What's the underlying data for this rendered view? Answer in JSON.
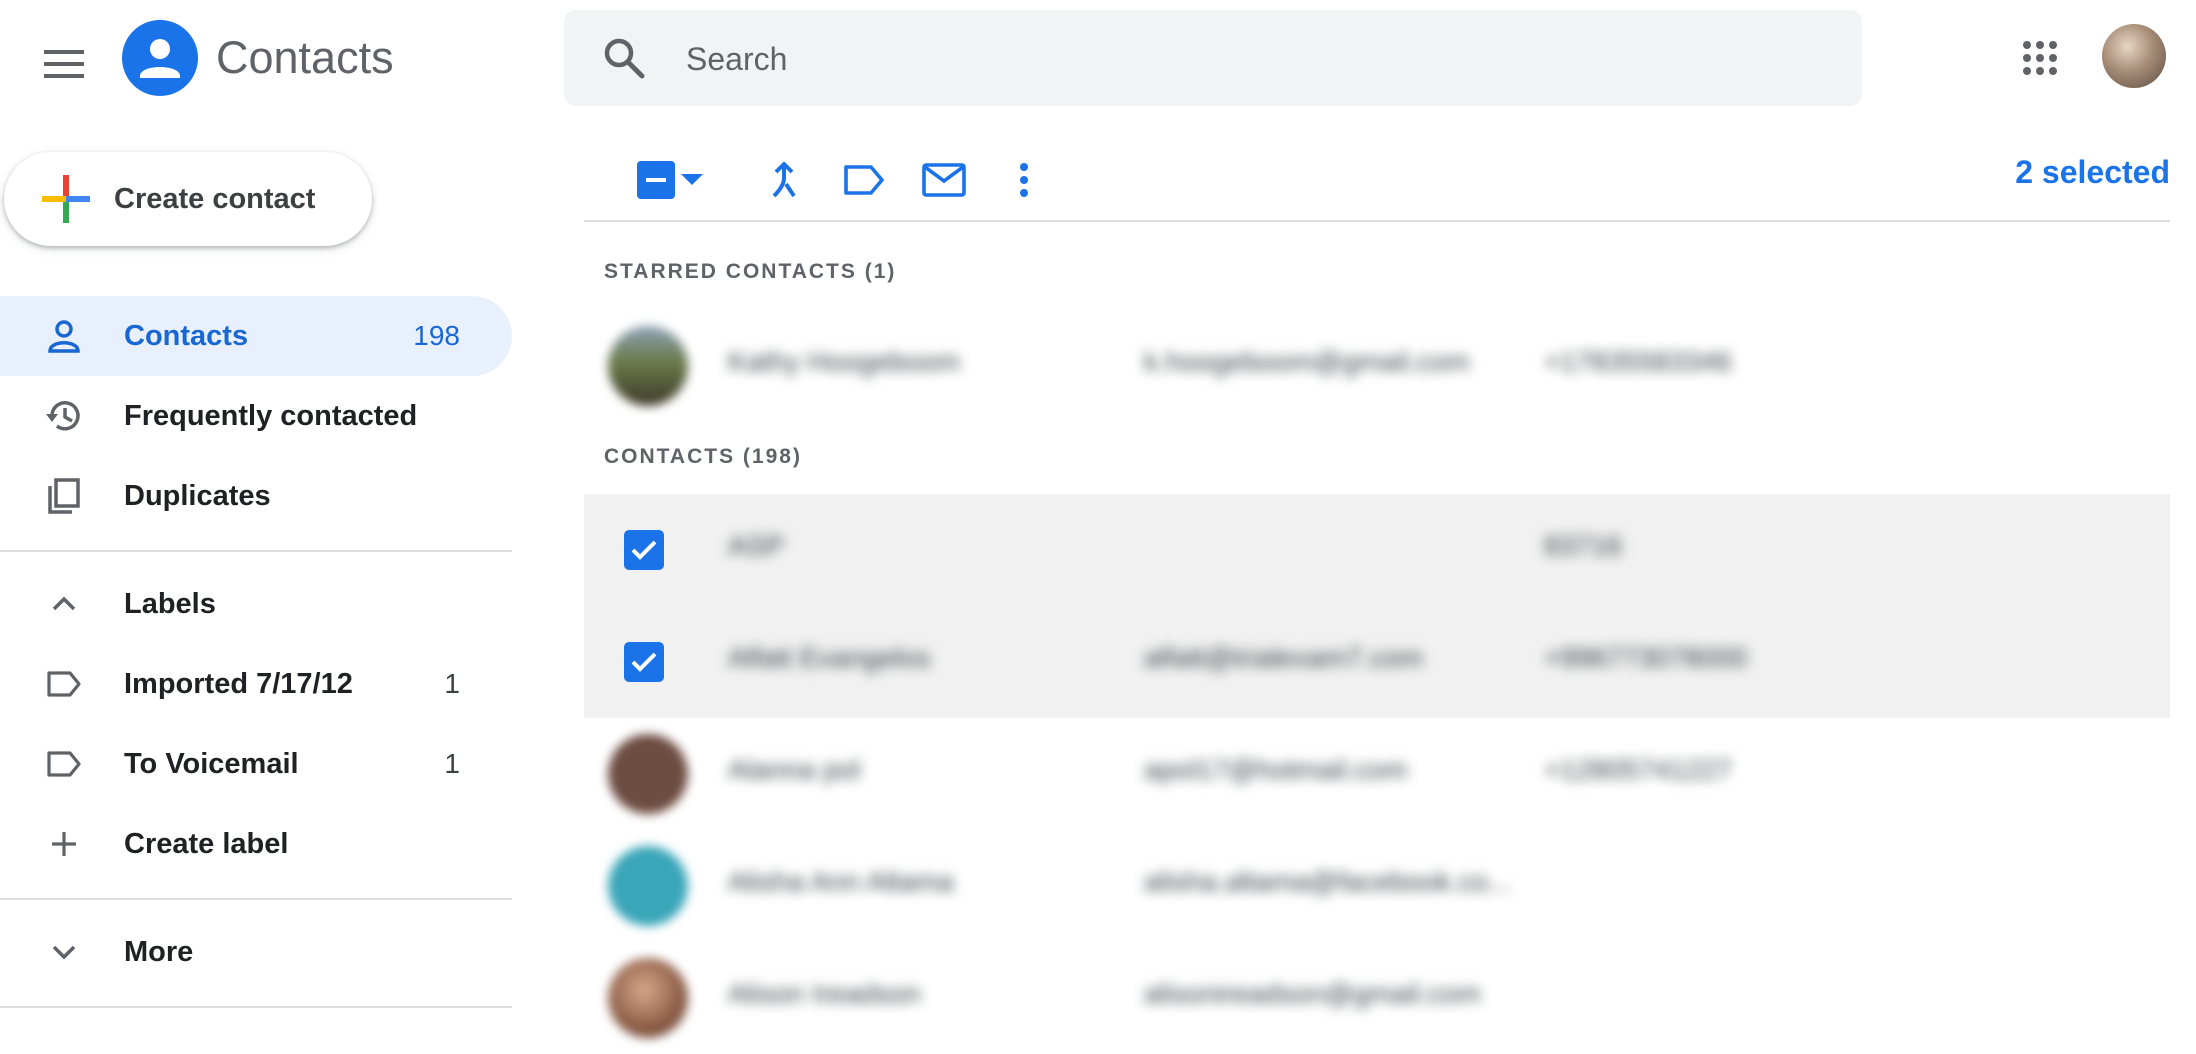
{
  "app": {
    "title": "Contacts"
  },
  "search": {
    "placeholder": "Search"
  },
  "sidebar": {
    "create_label": "Create contact",
    "nav": [
      {
        "label": "Contacts",
        "count": "198",
        "icon": "person-icon"
      },
      {
        "label": "Frequently contacted",
        "icon": "history-icon"
      },
      {
        "label": "Duplicates",
        "icon": "copy-icon"
      }
    ],
    "labels_header": "Labels",
    "labels": [
      {
        "label": "Imported 7/17/12",
        "count": "1",
        "icon": "label-icon"
      },
      {
        "label": "To Voicemail",
        "count": "1",
        "icon": "label-icon"
      }
    ],
    "create_label_action": "Create label",
    "more": "More"
  },
  "toolbar": {
    "selected_text": "2 selected"
  },
  "list": {
    "starred_header": "STARRED CONTACTS (1)",
    "contacts_header": "CONTACTS (198)",
    "starred": [
      {
        "name": "Kathy Hoogeboom",
        "email": "k.hoogeboom@gmail.com",
        "phone": "+17835583346"
      }
    ],
    "contacts": [
      {
        "name": "ASP",
        "email": "",
        "phone": "83716",
        "selected": true
      },
      {
        "name": "Alfatt Evangelos",
        "email": "alfatt@trialexam7.com",
        "phone": "+996773078000",
        "selected": true
      },
      {
        "name": "Alanna pol",
        "email": "apol17@hotmail.com",
        "phone": "+12805741227",
        "selected": false
      },
      {
        "name": "Alisha Ann Altama",
        "email": "alisha.altama@facebook.co...",
        "phone": "",
        "selected": false
      },
      {
        "name": "Alison Ireadson",
        "email": "alisonireadson@gmail.com",
        "phone": "",
        "selected": false
      }
    ]
  },
  "colors": {
    "accent": "#1a73e8",
    "active_nav_bg": "#e8f0fe",
    "selected_row_bg": "#f1f1f1"
  }
}
